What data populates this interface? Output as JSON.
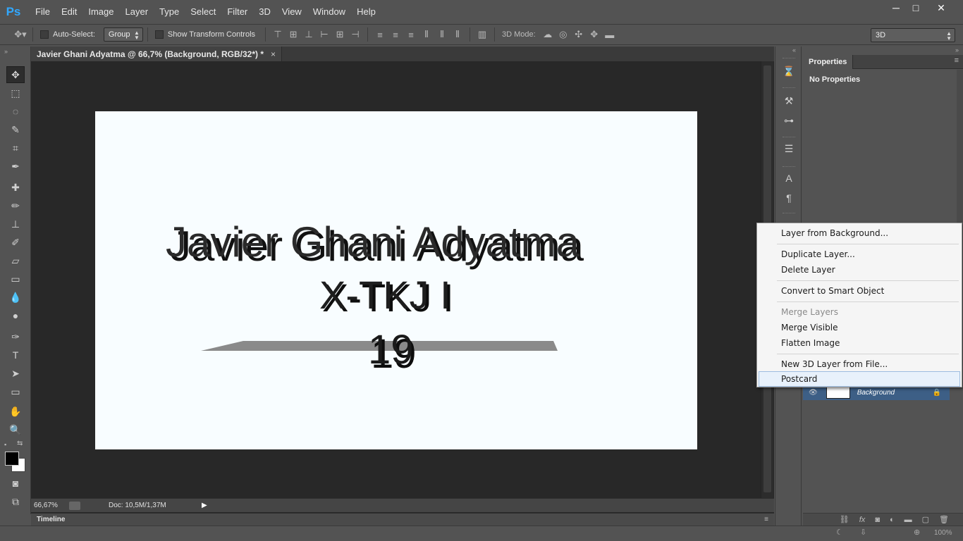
{
  "app": {
    "logo": "Ps"
  },
  "menubar": {
    "items": [
      "File",
      "Edit",
      "Image",
      "Layer",
      "Type",
      "Select",
      "Filter",
      "3D",
      "View",
      "Window",
      "Help"
    ]
  },
  "window_controls": {
    "minimize": "─",
    "maximize": "□",
    "close": "✕"
  },
  "options_bar": {
    "auto_select_label": "Auto-Select:",
    "auto_select_value": "Group",
    "show_transform_label": "Show Transform Controls",
    "mode_label": "3D Mode:",
    "workspace_value": "3D"
  },
  "document": {
    "tab_title": "Javier Ghani Adyatma @ 66,7% (Background, RGB/32*) *",
    "tab_close": "×",
    "canvas_text": {
      "line1": "Javier Ghani Adyatma",
      "line2": "X-TKJ I",
      "line3": "19"
    }
  },
  "status": {
    "zoom": "66,67%",
    "doc_info": "Doc: 10,5M/1,37M"
  },
  "timeline": {
    "label": "Timeline"
  },
  "properties_panel": {
    "tab": "Properties",
    "message": "No Properties"
  },
  "layers": {
    "background_name": "Background"
  },
  "bottom": {
    "zoom": "100%"
  },
  "context_menu": {
    "items": [
      {
        "label": "Layer from Background...",
        "disabled": false
      },
      {
        "label": "Duplicate Layer...",
        "disabled": false
      },
      {
        "label": "Delete Layer",
        "disabled": false
      },
      {
        "label": "Convert to Smart Object",
        "disabled": false
      },
      {
        "label": "Merge Layers",
        "disabled": true
      },
      {
        "label": "Merge Visible",
        "disabled": false
      },
      {
        "label": "Flatten Image",
        "disabled": false
      },
      {
        "label": "New 3D Layer from File...",
        "disabled": false
      },
      {
        "label": "Postcard",
        "disabled": false
      }
    ]
  },
  "colors": {
    "accent": "#31a8ff",
    "bg": "#535353",
    "workspace": "#282828",
    "selection": "#3d5f86"
  }
}
